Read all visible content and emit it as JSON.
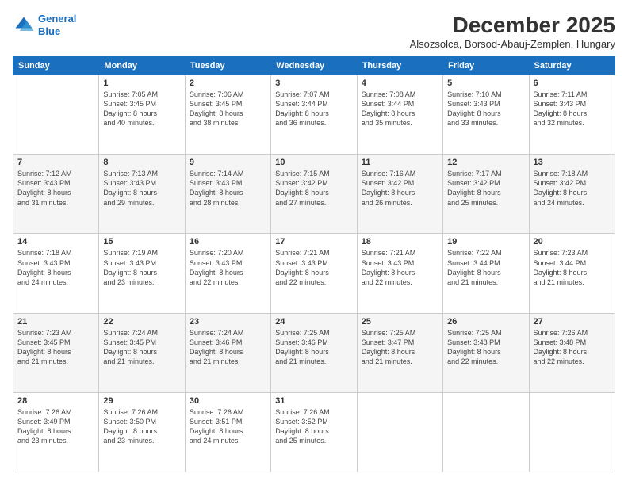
{
  "logo": {
    "line1": "General",
    "line2": "Blue"
  },
  "title": "December 2025",
  "subtitle": "Alsozsolca, Borsod-Abauj-Zemplen, Hungary",
  "days_of_week": [
    "Sunday",
    "Monday",
    "Tuesday",
    "Wednesday",
    "Thursday",
    "Friday",
    "Saturday"
  ],
  "weeks": [
    [
      {
        "day": "",
        "info": ""
      },
      {
        "day": "1",
        "info": "Sunrise: 7:05 AM\nSunset: 3:45 PM\nDaylight: 8 hours\nand 40 minutes."
      },
      {
        "day": "2",
        "info": "Sunrise: 7:06 AM\nSunset: 3:45 PM\nDaylight: 8 hours\nand 38 minutes."
      },
      {
        "day": "3",
        "info": "Sunrise: 7:07 AM\nSunset: 3:44 PM\nDaylight: 8 hours\nand 36 minutes."
      },
      {
        "day": "4",
        "info": "Sunrise: 7:08 AM\nSunset: 3:44 PM\nDaylight: 8 hours\nand 35 minutes."
      },
      {
        "day": "5",
        "info": "Sunrise: 7:10 AM\nSunset: 3:43 PM\nDaylight: 8 hours\nand 33 minutes."
      },
      {
        "day": "6",
        "info": "Sunrise: 7:11 AM\nSunset: 3:43 PM\nDaylight: 8 hours\nand 32 minutes."
      }
    ],
    [
      {
        "day": "7",
        "info": "Sunrise: 7:12 AM\nSunset: 3:43 PM\nDaylight: 8 hours\nand 31 minutes."
      },
      {
        "day": "8",
        "info": "Sunrise: 7:13 AM\nSunset: 3:43 PM\nDaylight: 8 hours\nand 29 minutes."
      },
      {
        "day": "9",
        "info": "Sunrise: 7:14 AM\nSunset: 3:43 PM\nDaylight: 8 hours\nand 28 minutes."
      },
      {
        "day": "10",
        "info": "Sunrise: 7:15 AM\nSunset: 3:42 PM\nDaylight: 8 hours\nand 27 minutes."
      },
      {
        "day": "11",
        "info": "Sunrise: 7:16 AM\nSunset: 3:42 PM\nDaylight: 8 hours\nand 26 minutes."
      },
      {
        "day": "12",
        "info": "Sunrise: 7:17 AM\nSunset: 3:42 PM\nDaylight: 8 hours\nand 25 minutes."
      },
      {
        "day": "13",
        "info": "Sunrise: 7:18 AM\nSunset: 3:42 PM\nDaylight: 8 hours\nand 24 minutes."
      }
    ],
    [
      {
        "day": "14",
        "info": "Sunrise: 7:18 AM\nSunset: 3:43 PM\nDaylight: 8 hours\nand 24 minutes."
      },
      {
        "day": "15",
        "info": "Sunrise: 7:19 AM\nSunset: 3:43 PM\nDaylight: 8 hours\nand 23 minutes."
      },
      {
        "day": "16",
        "info": "Sunrise: 7:20 AM\nSunset: 3:43 PM\nDaylight: 8 hours\nand 22 minutes."
      },
      {
        "day": "17",
        "info": "Sunrise: 7:21 AM\nSunset: 3:43 PM\nDaylight: 8 hours\nand 22 minutes."
      },
      {
        "day": "18",
        "info": "Sunrise: 7:21 AM\nSunset: 3:43 PM\nDaylight: 8 hours\nand 22 minutes."
      },
      {
        "day": "19",
        "info": "Sunrise: 7:22 AM\nSunset: 3:44 PM\nDaylight: 8 hours\nand 21 minutes."
      },
      {
        "day": "20",
        "info": "Sunrise: 7:23 AM\nSunset: 3:44 PM\nDaylight: 8 hours\nand 21 minutes."
      }
    ],
    [
      {
        "day": "21",
        "info": "Sunrise: 7:23 AM\nSunset: 3:45 PM\nDaylight: 8 hours\nand 21 minutes."
      },
      {
        "day": "22",
        "info": "Sunrise: 7:24 AM\nSunset: 3:45 PM\nDaylight: 8 hours\nand 21 minutes."
      },
      {
        "day": "23",
        "info": "Sunrise: 7:24 AM\nSunset: 3:46 PM\nDaylight: 8 hours\nand 21 minutes."
      },
      {
        "day": "24",
        "info": "Sunrise: 7:25 AM\nSunset: 3:46 PM\nDaylight: 8 hours\nand 21 minutes."
      },
      {
        "day": "25",
        "info": "Sunrise: 7:25 AM\nSunset: 3:47 PM\nDaylight: 8 hours\nand 21 minutes."
      },
      {
        "day": "26",
        "info": "Sunrise: 7:25 AM\nSunset: 3:48 PM\nDaylight: 8 hours\nand 22 minutes."
      },
      {
        "day": "27",
        "info": "Sunrise: 7:26 AM\nSunset: 3:48 PM\nDaylight: 8 hours\nand 22 minutes."
      }
    ],
    [
      {
        "day": "28",
        "info": "Sunrise: 7:26 AM\nSunset: 3:49 PM\nDaylight: 8 hours\nand 23 minutes."
      },
      {
        "day": "29",
        "info": "Sunrise: 7:26 AM\nSunset: 3:50 PM\nDaylight: 8 hours\nand 23 minutes."
      },
      {
        "day": "30",
        "info": "Sunrise: 7:26 AM\nSunset: 3:51 PM\nDaylight: 8 hours\nand 24 minutes."
      },
      {
        "day": "31",
        "info": "Sunrise: 7:26 AM\nSunset: 3:52 PM\nDaylight: 8 hours\nand 25 minutes."
      },
      {
        "day": "",
        "info": ""
      },
      {
        "day": "",
        "info": ""
      },
      {
        "day": "",
        "info": ""
      }
    ]
  ]
}
